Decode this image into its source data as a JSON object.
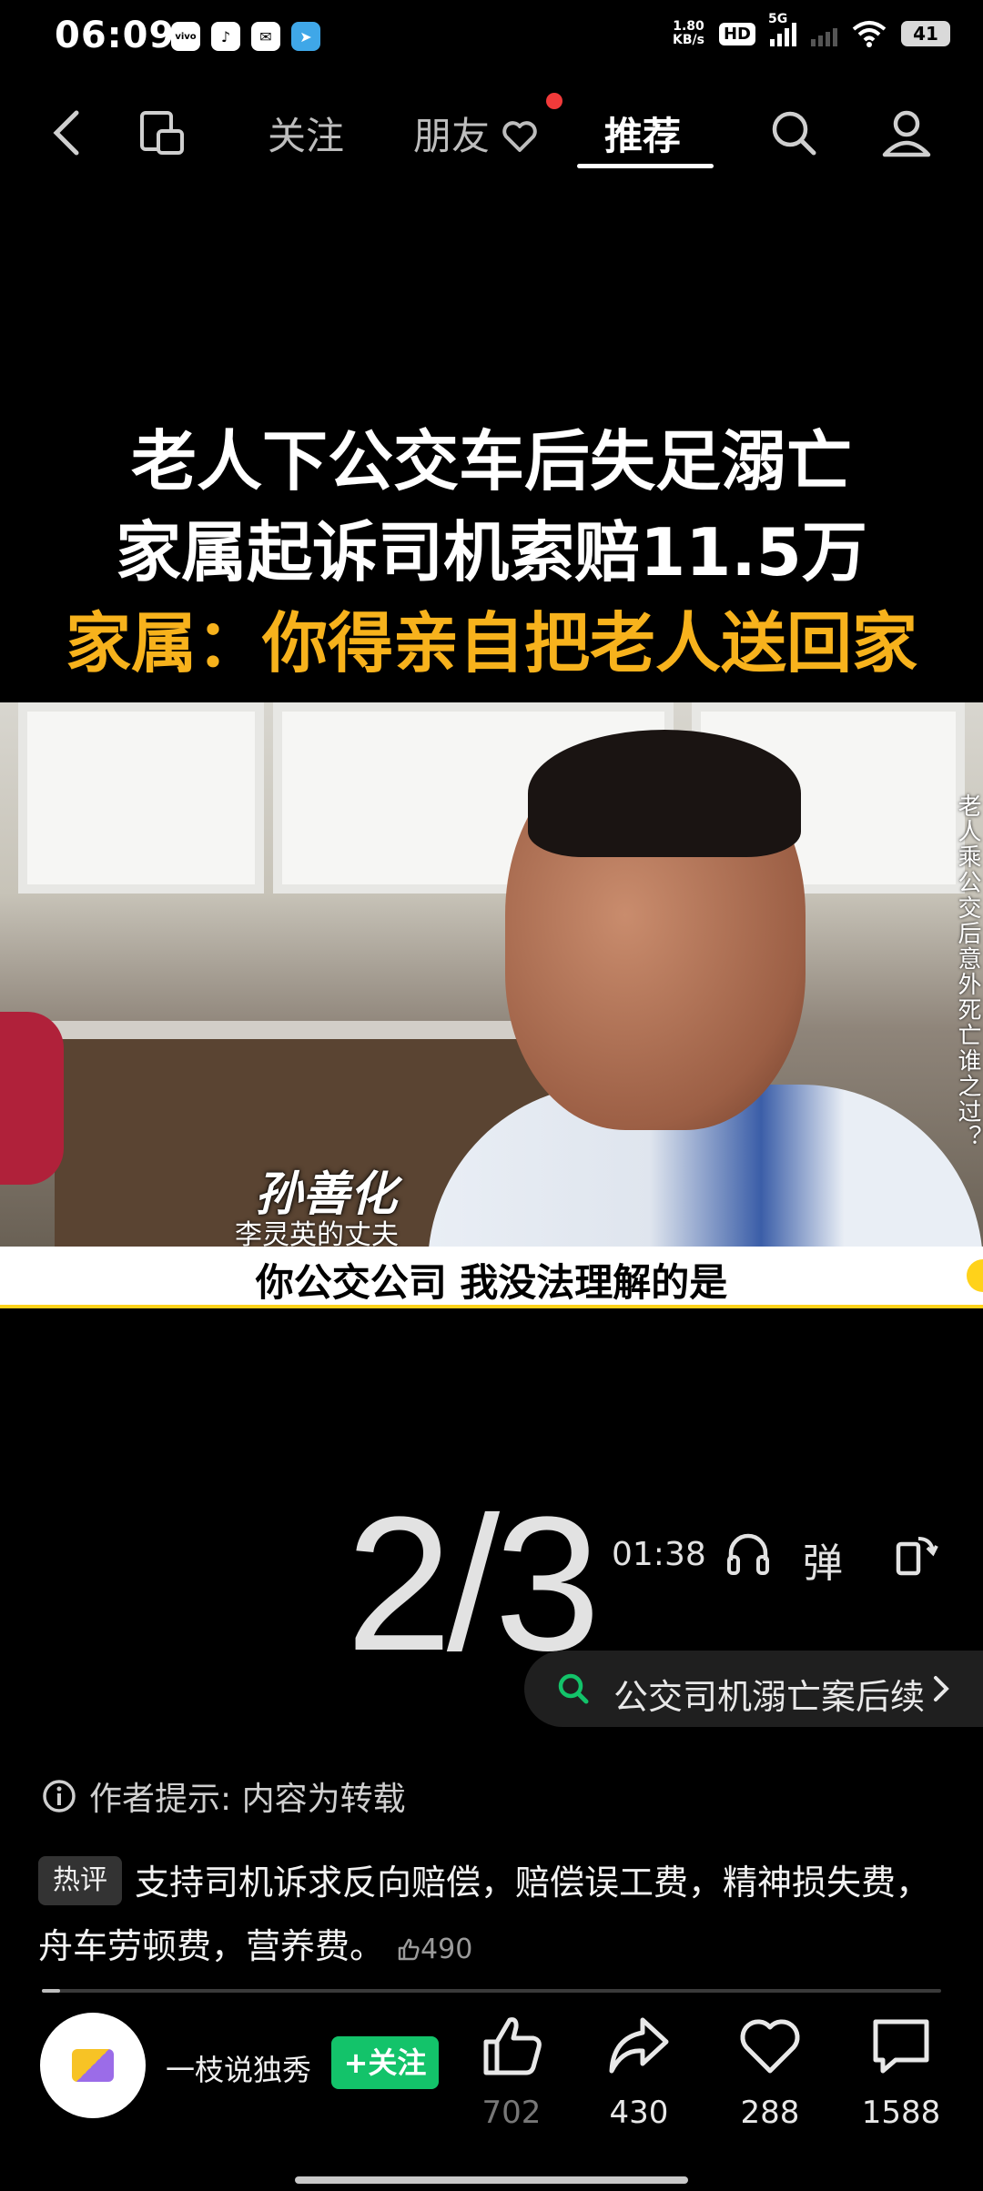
{
  "status_bar": {
    "time": "06:09",
    "net_speed_value": "1.80",
    "net_speed_unit": "KB/s",
    "hd_label": "HD",
    "network_label": "5G",
    "battery": "41"
  },
  "top_nav": {
    "tabs": [
      {
        "label": "关注"
      },
      {
        "label": "朋友"
      },
      {
        "label": "推荐"
      }
    ],
    "active_tab": "推荐"
  },
  "video": {
    "headline_line1": "老人下公交车后失足溺亡",
    "headline_line2": "家属起诉司机索赔11.5万",
    "headline_line3": "家属：你得亲自把老人送回家",
    "side_caption": "老人乘公交后意外死亡谁之过？",
    "name_caption": "孙善化",
    "name_subcaption": "李灵英的丈夫",
    "subtitle": "你公交公司 我没法理解的是"
  },
  "controls": {
    "page_indicator": "2/3",
    "duration": "01:38",
    "danmu_label": "弹"
  },
  "search_suggestion": "公交司机溺亡案后续",
  "author_tip": "作者提示: 内容为转载",
  "hot_comment": {
    "tag": "热评",
    "text": "支持司机诉求反向赔偿，赔偿误工费，精神损失费，舟车劳顿费，营养费。",
    "likes": "490"
  },
  "progress": 0.02,
  "author": {
    "name": "一枝说独秀",
    "follow_label": "+关注"
  },
  "actions": {
    "like_count": "702",
    "share_count": "430",
    "favorite_count": "288",
    "comment_count": "1588"
  },
  "colors": {
    "accent_orange": "#f7b21c",
    "follow_green": "#13c36a",
    "notification_red": "#f23a3a"
  }
}
